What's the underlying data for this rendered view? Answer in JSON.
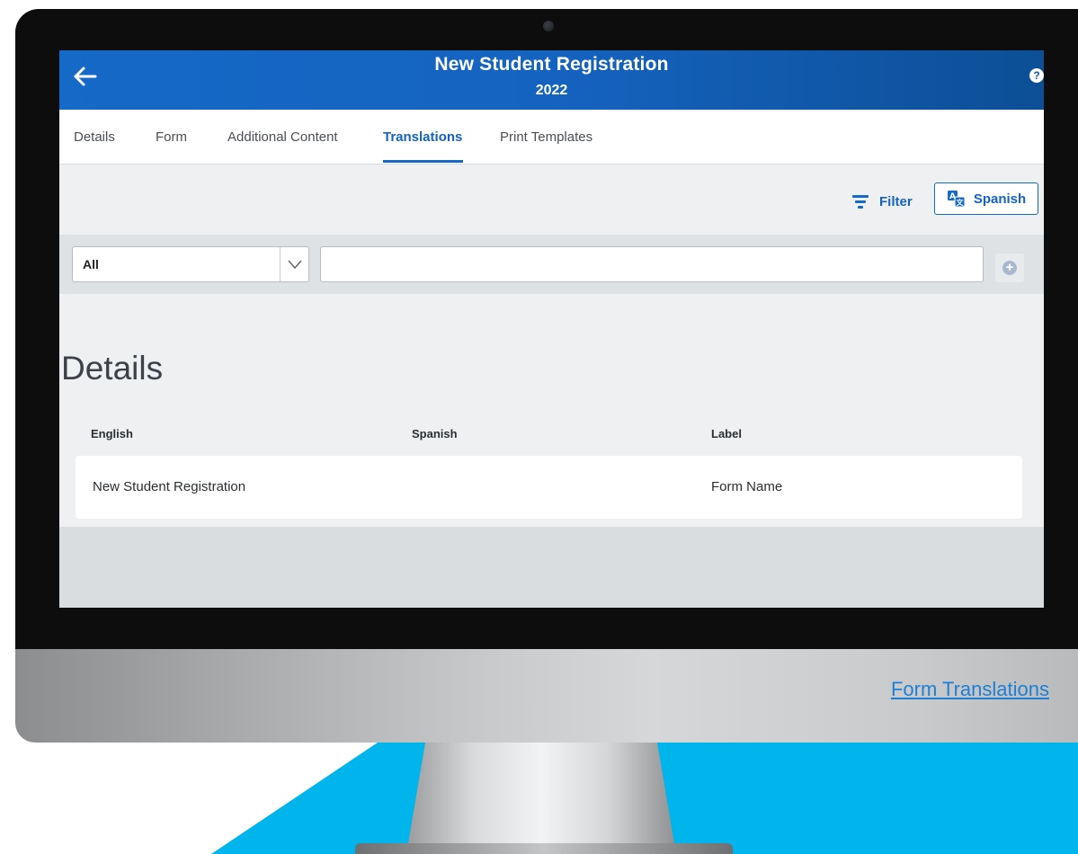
{
  "header": {
    "title": "New Student Registration",
    "subtitle": "2022",
    "help_glyph": "?"
  },
  "tabs": [
    {
      "label": "Details",
      "active": false
    },
    {
      "label": "Form",
      "active": false
    },
    {
      "label": "Additional Content",
      "active": false
    },
    {
      "label": "Translations",
      "active": true
    },
    {
      "label": "Print Templates",
      "active": false
    }
  ],
  "toolbar": {
    "filter_label": "Filter",
    "language_label": "Spanish"
  },
  "search": {
    "select_value": "All",
    "input_value": "",
    "add_glyph": "+"
  },
  "section": {
    "title": "Details",
    "columns": [
      "English",
      "Spanish",
      "Label"
    ],
    "rows": [
      {
        "english": "New Student Registration",
        "spanish": "",
        "label": "Form Name"
      }
    ]
  },
  "footer_link": "Form Translations",
  "colors": {
    "primary": "#1569c7",
    "accent_blue": "#00b4ec",
    "screen_bg": "#eef0f1"
  },
  "icons": [
    "back-arrow-icon",
    "help-icon",
    "filter-icon",
    "translate-icon",
    "chevron-down-icon",
    "add-circle-icon",
    "camera-icon"
  ]
}
